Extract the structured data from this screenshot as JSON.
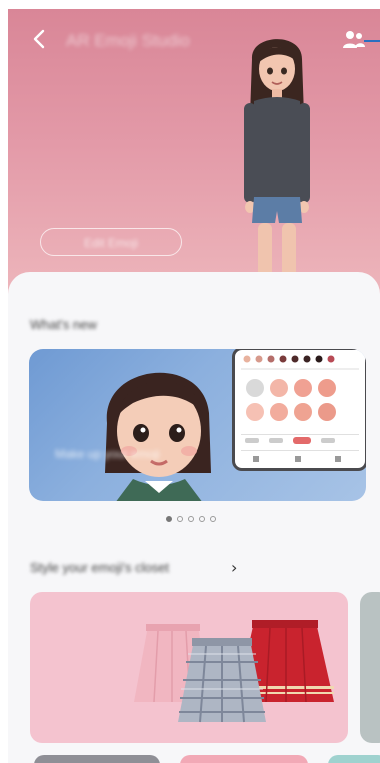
{
  "header": {
    "title": "AR Emoji Studio",
    "back_icon": "chevron-left-icon",
    "people_icon": "people-icon"
  },
  "hero": {
    "pill_label": "Edit Emoji"
  },
  "whats_new": {
    "title": "What's new",
    "banner_text": "Make up your emoji",
    "page_count": 5,
    "active_page": 1
  },
  "section": {
    "title": "Style your emoji's closet",
    "arrow": "›"
  },
  "colors": {
    "hero_top": "#d98697",
    "hero_bottom": "#eeb8bd",
    "sheet": "#f7f7f9",
    "banner": "#8cb0de",
    "card_pink": "#f4c3cf",
    "callout": "#2a6fc0"
  }
}
